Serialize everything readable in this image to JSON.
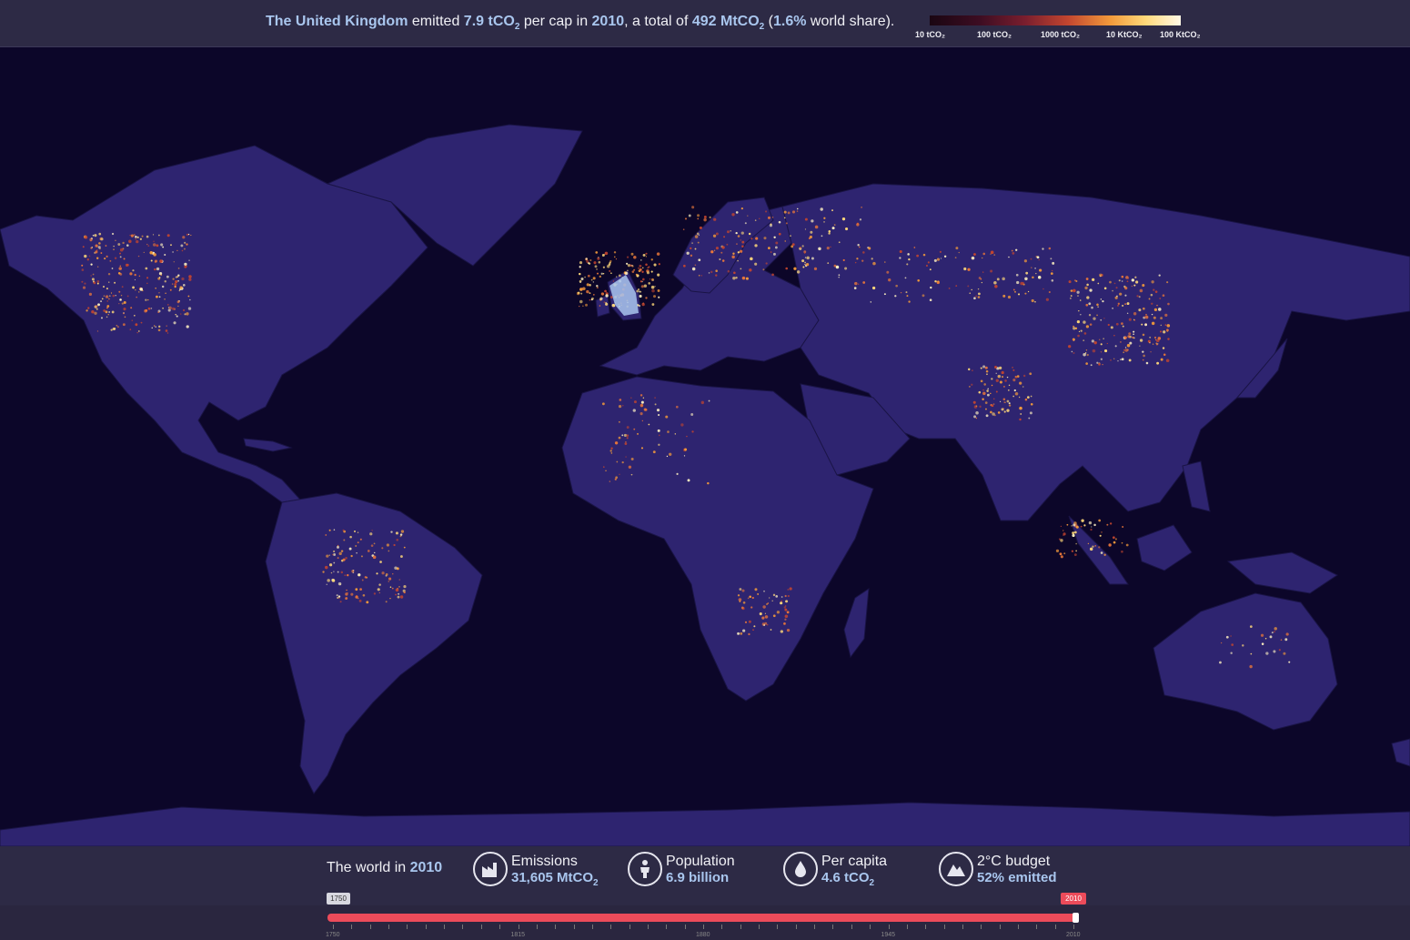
{
  "headline": {
    "country": "The United Kingdom",
    "t1": " emitted ",
    "per_cap_value": "7.9 tCO",
    "t2": " per cap in ",
    "year": "2010",
    "t3": ", a total of ",
    "total_value": "492 MtCO",
    "t4": " (",
    "world_share": "1.6%",
    "t5": " world share).",
    "sub": "2"
  },
  "legend": {
    "ticks": [
      "10 tCO₂",
      "100 tCO₂",
      "1000 tCO₂",
      "10 KtCO₂",
      "100 KtCO₂"
    ]
  },
  "colors": {
    "ocean": "#0c0629",
    "land": "#2e2470",
    "border": "#1a1446",
    "highlight": "#a9c6ee",
    "accent": "#ec4b5a"
  },
  "summary": {
    "prefix": "The world in ",
    "year": "2010"
  },
  "stats": [
    {
      "icon": "factory-icon",
      "label": "Emissions",
      "value": "31,605 MtCO",
      "sub": "2"
    },
    {
      "icon": "person-icon",
      "label": "Population",
      "value": "6.9 billion",
      "sub": ""
    },
    {
      "icon": "drop-icon",
      "label": "Per capita",
      "value": "4.6 tCO",
      "sub": "2"
    },
    {
      "icon": "mountain-icon",
      "label": "2°C budget",
      "value": "52% emitted",
      "sub": ""
    }
  ],
  "timeline": {
    "start_label": "1750",
    "end_label": "2010",
    "axis_labels": [
      "1750",
      "1815",
      "1880",
      "1945",
      "2010"
    ],
    "range": [
      1750,
      2010
    ],
    "selected_year": 2010
  }
}
